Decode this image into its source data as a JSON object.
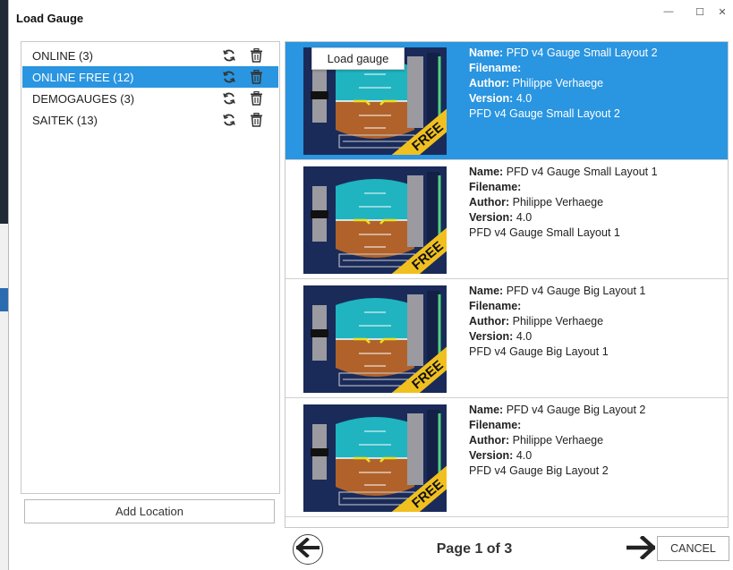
{
  "window": {
    "title": "Load Gauge",
    "minimize_glyph": "—",
    "maximize_glyph": "☐",
    "close_glyph": "✕"
  },
  "locations": [
    {
      "label": "ONLINE (3)",
      "selected": false
    },
    {
      "label": "ONLINE FREE (12)",
      "selected": true
    },
    {
      "label": "DEMOGAUGES (3)",
      "selected": false
    },
    {
      "label": "SAITEK (13)",
      "selected": false
    }
  ],
  "add_location_label": "Add Location",
  "tooltip": "Load gauge",
  "gauge_badge": "FREE",
  "field_labels": {
    "name": "Name:",
    "filename": "Filename:",
    "author": "Author:",
    "version": "Version:"
  },
  "gauges": [
    {
      "name": "PFD v4 Gauge Small Layout 2",
      "filename": "",
      "author": "Philippe Verhaege",
      "version": "4.0",
      "description": "PFD v4 Gauge Small Layout 2",
      "selected": true
    },
    {
      "name": "PFD v4 Gauge Small Layout 1",
      "filename": "",
      "author": "Philippe Verhaege",
      "version": "4.0",
      "description": "PFD v4 Gauge Small Layout 1",
      "selected": false
    },
    {
      "name": "PFD v4 Gauge Big Layout 1",
      "filename": "",
      "author": "Philippe Verhaege",
      "version": "4.0",
      "description": "PFD v4 Gauge Big Layout 1",
      "selected": false
    },
    {
      "name": "PFD v4 Gauge Big Layout 2",
      "filename": "",
      "author": "Philippe Verhaege",
      "version": "4.0",
      "description": "PFD v4 Gauge Big Layout 2",
      "selected": false
    }
  ],
  "pager": {
    "label": "Page 1 of 3"
  },
  "cancel_label": "CANCEL",
  "colors": {
    "selection": "#2a95e0",
    "sky": "#1fb4c0",
    "ground": "#b0622a",
    "badge": "#f0c020"
  },
  "icons": {
    "refresh": "refresh-icon",
    "delete": "trash-icon",
    "prev": "arrow-left-icon",
    "next": "arrow-right-icon"
  }
}
